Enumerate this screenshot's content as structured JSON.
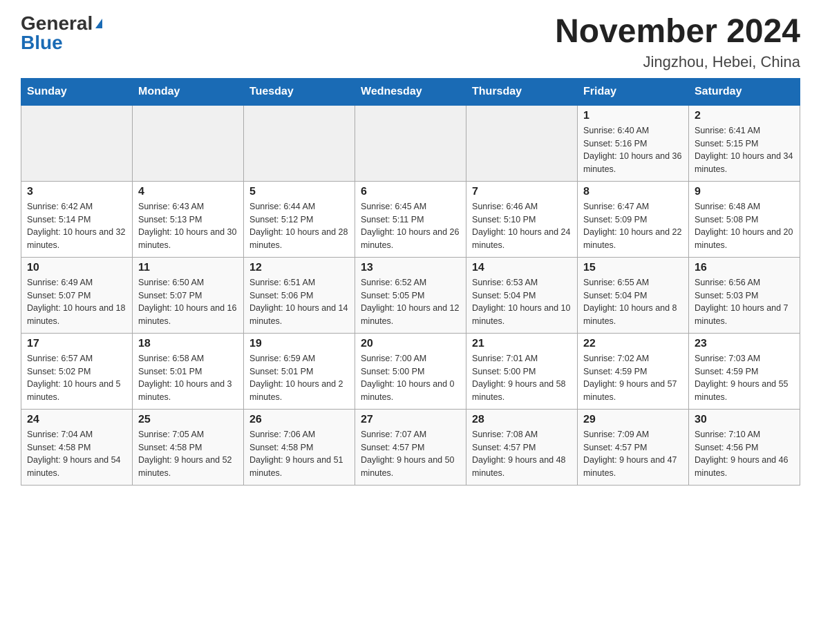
{
  "header": {
    "logo_general": "General",
    "logo_blue": "Blue",
    "month_title": "November 2024",
    "location": "Jingzhou, Hebei, China"
  },
  "weekdays": [
    "Sunday",
    "Monday",
    "Tuesday",
    "Wednesday",
    "Thursday",
    "Friday",
    "Saturday"
  ],
  "weeks": [
    [
      {
        "day": "",
        "sunrise": "",
        "sunset": "",
        "daylight": ""
      },
      {
        "day": "",
        "sunrise": "",
        "sunset": "",
        "daylight": ""
      },
      {
        "day": "",
        "sunrise": "",
        "sunset": "",
        "daylight": ""
      },
      {
        "day": "",
        "sunrise": "",
        "sunset": "",
        "daylight": ""
      },
      {
        "day": "",
        "sunrise": "",
        "sunset": "",
        "daylight": ""
      },
      {
        "day": "1",
        "sunrise": "Sunrise: 6:40 AM",
        "sunset": "Sunset: 5:16 PM",
        "daylight": "Daylight: 10 hours and 36 minutes."
      },
      {
        "day": "2",
        "sunrise": "Sunrise: 6:41 AM",
        "sunset": "Sunset: 5:15 PM",
        "daylight": "Daylight: 10 hours and 34 minutes."
      }
    ],
    [
      {
        "day": "3",
        "sunrise": "Sunrise: 6:42 AM",
        "sunset": "Sunset: 5:14 PM",
        "daylight": "Daylight: 10 hours and 32 minutes."
      },
      {
        "day": "4",
        "sunrise": "Sunrise: 6:43 AM",
        "sunset": "Sunset: 5:13 PM",
        "daylight": "Daylight: 10 hours and 30 minutes."
      },
      {
        "day": "5",
        "sunrise": "Sunrise: 6:44 AM",
        "sunset": "Sunset: 5:12 PM",
        "daylight": "Daylight: 10 hours and 28 minutes."
      },
      {
        "day": "6",
        "sunrise": "Sunrise: 6:45 AM",
        "sunset": "Sunset: 5:11 PM",
        "daylight": "Daylight: 10 hours and 26 minutes."
      },
      {
        "day": "7",
        "sunrise": "Sunrise: 6:46 AM",
        "sunset": "Sunset: 5:10 PM",
        "daylight": "Daylight: 10 hours and 24 minutes."
      },
      {
        "day": "8",
        "sunrise": "Sunrise: 6:47 AM",
        "sunset": "Sunset: 5:09 PM",
        "daylight": "Daylight: 10 hours and 22 minutes."
      },
      {
        "day": "9",
        "sunrise": "Sunrise: 6:48 AM",
        "sunset": "Sunset: 5:08 PM",
        "daylight": "Daylight: 10 hours and 20 minutes."
      }
    ],
    [
      {
        "day": "10",
        "sunrise": "Sunrise: 6:49 AM",
        "sunset": "Sunset: 5:07 PM",
        "daylight": "Daylight: 10 hours and 18 minutes."
      },
      {
        "day": "11",
        "sunrise": "Sunrise: 6:50 AM",
        "sunset": "Sunset: 5:07 PM",
        "daylight": "Daylight: 10 hours and 16 minutes."
      },
      {
        "day": "12",
        "sunrise": "Sunrise: 6:51 AM",
        "sunset": "Sunset: 5:06 PM",
        "daylight": "Daylight: 10 hours and 14 minutes."
      },
      {
        "day": "13",
        "sunrise": "Sunrise: 6:52 AM",
        "sunset": "Sunset: 5:05 PM",
        "daylight": "Daylight: 10 hours and 12 minutes."
      },
      {
        "day": "14",
        "sunrise": "Sunrise: 6:53 AM",
        "sunset": "Sunset: 5:04 PM",
        "daylight": "Daylight: 10 hours and 10 minutes."
      },
      {
        "day": "15",
        "sunrise": "Sunrise: 6:55 AM",
        "sunset": "Sunset: 5:04 PM",
        "daylight": "Daylight: 10 hours and 8 minutes."
      },
      {
        "day": "16",
        "sunrise": "Sunrise: 6:56 AM",
        "sunset": "Sunset: 5:03 PM",
        "daylight": "Daylight: 10 hours and 7 minutes."
      }
    ],
    [
      {
        "day": "17",
        "sunrise": "Sunrise: 6:57 AM",
        "sunset": "Sunset: 5:02 PM",
        "daylight": "Daylight: 10 hours and 5 minutes."
      },
      {
        "day": "18",
        "sunrise": "Sunrise: 6:58 AM",
        "sunset": "Sunset: 5:01 PM",
        "daylight": "Daylight: 10 hours and 3 minutes."
      },
      {
        "day": "19",
        "sunrise": "Sunrise: 6:59 AM",
        "sunset": "Sunset: 5:01 PM",
        "daylight": "Daylight: 10 hours and 2 minutes."
      },
      {
        "day": "20",
        "sunrise": "Sunrise: 7:00 AM",
        "sunset": "Sunset: 5:00 PM",
        "daylight": "Daylight: 10 hours and 0 minutes."
      },
      {
        "day": "21",
        "sunrise": "Sunrise: 7:01 AM",
        "sunset": "Sunset: 5:00 PM",
        "daylight": "Daylight: 9 hours and 58 minutes."
      },
      {
        "day": "22",
        "sunrise": "Sunrise: 7:02 AM",
        "sunset": "Sunset: 4:59 PM",
        "daylight": "Daylight: 9 hours and 57 minutes."
      },
      {
        "day": "23",
        "sunrise": "Sunrise: 7:03 AM",
        "sunset": "Sunset: 4:59 PM",
        "daylight": "Daylight: 9 hours and 55 minutes."
      }
    ],
    [
      {
        "day": "24",
        "sunrise": "Sunrise: 7:04 AM",
        "sunset": "Sunset: 4:58 PM",
        "daylight": "Daylight: 9 hours and 54 minutes."
      },
      {
        "day": "25",
        "sunrise": "Sunrise: 7:05 AM",
        "sunset": "Sunset: 4:58 PM",
        "daylight": "Daylight: 9 hours and 52 minutes."
      },
      {
        "day": "26",
        "sunrise": "Sunrise: 7:06 AM",
        "sunset": "Sunset: 4:58 PM",
        "daylight": "Daylight: 9 hours and 51 minutes."
      },
      {
        "day": "27",
        "sunrise": "Sunrise: 7:07 AM",
        "sunset": "Sunset: 4:57 PM",
        "daylight": "Daylight: 9 hours and 50 minutes."
      },
      {
        "day": "28",
        "sunrise": "Sunrise: 7:08 AM",
        "sunset": "Sunset: 4:57 PM",
        "daylight": "Daylight: 9 hours and 48 minutes."
      },
      {
        "day": "29",
        "sunrise": "Sunrise: 7:09 AM",
        "sunset": "Sunset: 4:57 PM",
        "daylight": "Daylight: 9 hours and 47 minutes."
      },
      {
        "day": "30",
        "sunrise": "Sunrise: 7:10 AM",
        "sunset": "Sunset: 4:56 PM",
        "daylight": "Daylight: 9 hours and 46 minutes."
      }
    ]
  ]
}
